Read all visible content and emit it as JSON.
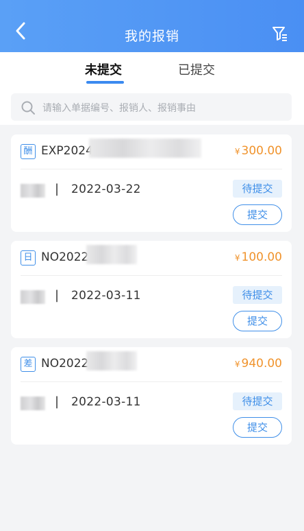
{
  "header": {
    "title": "我的报销",
    "back_icon": "chevron-left-icon",
    "filter_icon": "filter-icon"
  },
  "tabs": [
    {
      "label": "未提交",
      "active": true
    },
    {
      "label": "已提交",
      "active": false
    }
  ],
  "search": {
    "placeholder": "请输入单据编号、报销人、报销事由"
  },
  "cards": [
    {
      "type_char": "酬",
      "doc_no": "EXP2024",
      "currency": "¥",
      "amount": "300.00",
      "date": "2022-03-22",
      "separator": "|",
      "status": "待提交",
      "action": "提交"
    },
    {
      "type_char": "日",
      "doc_no": "NO2022",
      "currency": "¥",
      "amount": "100.00",
      "date": "2022-03-11",
      "separator": "|",
      "status": "待提交",
      "action": "提交"
    },
    {
      "type_char": "差",
      "doc_no": "NO2022",
      "currency": "¥",
      "amount": "940.00",
      "date": "2022-03-11",
      "separator": "|",
      "status": "待提交",
      "action": "提交"
    }
  ],
  "colors": {
    "header_blue": "#4a8ff3",
    "accent_blue": "#3e8ee8",
    "amount_orange": "#f0932c"
  }
}
